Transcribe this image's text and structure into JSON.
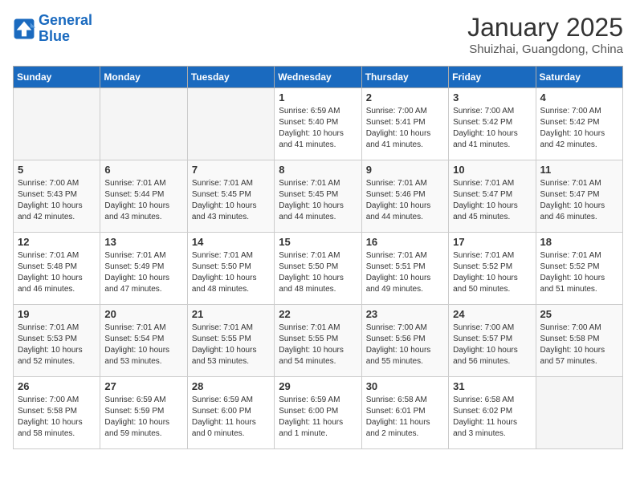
{
  "header": {
    "logo_line1": "General",
    "logo_line2": "Blue",
    "month": "January 2025",
    "location": "Shuizhai, Guangdong, China"
  },
  "days_of_week": [
    "Sunday",
    "Monday",
    "Tuesday",
    "Wednesday",
    "Thursday",
    "Friday",
    "Saturday"
  ],
  "weeks": [
    [
      {
        "day": "",
        "info": ""
      },
      {
        "day": "",
        "info": ""
      },
      {
        "day": "",
        "info": ""
      },
      {
        "day": "1",
        "info": "Sunrise: 6:59 AM\nSunset: 5:40 PM\nDaylight: 10 hours\nand 41 minutes."
      },
      {
        "day": "2",
        "info": "Sunrise: 7:00 AM\nSunset: 5:41 PM\nDaylight: 10 hours\nand 41 minutes."
      },
      {
        "day": "3",
        "info": "Sunrise: 7:00 AM\nSunset: 5:42 PM\nDaylight: 10 hours\nand 41 minutes."
      },
      {
        "day": "4",
        "info": "Sunrise: 7:00 AM\nSunset: 5:42 PM\nDaylight: 10 hours\nand 42 minutes."
      }
    ],
    [
      {
        "day": "5",
        "info": "Sunrise: 7:00 AM\nSunset: 5:43 PM\nDaylight: 10 hours\nand 42 minutes."
      },
      {
        "day": "6",
        "info": "Sunrise: 7:01 AM\nSunset: 5:44 PM\nDaylight: 10 hours\nand 43 minutes."
      },
      {
        "day": "7",
        "info": "Sunrise: 7:01 AM\nSunset: 5:45 PM\nDaylight: 10 hours\nand 43 minutes."
      },
      {
        "day": "8",
        "info": "Sunrise: 7:01 AM\nSunset: 5:45 PM\nDaylight: 10 hours\nand 44 minutes."
      },
      {
        "day": "9",
        "info": "Sunrise: 7:01 AM\nSunset: 5:46 PM\nDaylight: 10 hours\nand 44 minutes."
      },
      {
        "day": "10",
        "info": "Sunrise: 7:01 AM\nSunset: 5:47 PM\nDaylight: 10 hours\nand 45 minutes."
      },
      {
        "day": "11",
        "info": "Sunrise: 7:01 AM\nSunset: 5:47 PM\nDaylight: 10 hours\nand 46 minutes."
      }
    ],
    [
      {
        "day": "12",
        "info": "Sunrise: 7:01 AM\nSunset: 5:48 PM\nDaylight: 10 hours\nand 46 minutes."
      },
      {
        "day": "13",
        "info": "Sunrise: 7:01 AM\nSunset: 5:49 PM\nDaylight: 10 hours\nand 47 minutes."
      },
      {
        "day": "14",
        "info": "Sunrise: 7:01 AM\nSunset: 5:50 PM\nDaylight: 10 hours\nand 48 minutes."
      },
      {
        "day": "15",
        "info": "Sunrise: 7:01 AM\nSunset: 5:50 PM\nDaylight: 10 hours\nand 48 minutes."
      },
      {
        "day": "16",
        "info": "Sunrise: 7:01 AM\nSunset: 5:51 PM\nDaylight: 10 hours\nand 49 minutes."
      },
      {
        "day": "17",
        "info": "Sunrise: 7:01 AM\nSunset: 5:52 PM\nDaylight: 10 hours\nand 50 minutes."
      },
      {
        "day": "18",
        "info": "Sunrise: 7:01 AM\nSunset: 5:52 PM\nDaylight: 10 hours\nand 51 minutes."
      }
    ],
    [
      {
        "day": "19",
        "info": "Sunrise: 7:01 AM\nSunset: 5:53 PM\nDaylight: 10 hours\nand 52 minutes."
      },
      {
        "day": "20",
        "info": "Sunrise: 7:01 AM\nSunset: 5:54 PM\nDaylight: 10 hours\nand 53 minutes."
      },
      {
        "day": "21",
        "info": "Sunrise: 7:01 AM\nSunset: 5:55 PM\nDaylight: 10 hours\nand 53 minutes."
      },
      {
        "day": "22",
        "info": "Sunrise: 7:01 AM\nSunset: 5:55 PM\nDaylight: 10 hours\nand 54 minutes."
      },
      {
        "day": "23",
        "info": "Sunrise: 7:00 AM\nSunset: 5:56 PM\nDaylight: 10 hours\nand 55 minutes."
      },
      {
        "day": "24",
        "info": "Sunrise: 7:00 AM\nSunset: 5:57 PM\nDaylight: 10 hours\nand 56 minutes."
      },
      {
        "day": "25",
        "info": "Sunrise: 7:00 AM\nSunset: 5:58 PM\nDaylight: 10 hours\nand 57 minutes."
      }
    ],
    [
      {
        "day": "26",
        "info": "Sunrise: 7:00 AM\nSunset: 5:58 PM\nDaylight: 10 hours\nand 58 minutes."
      },
      {
        "day": "27",
        "info": "Sunrise: 6:59 AM\nSunset: 5:59 PM\nDaylight: 10 hours\nand 59 minutes."
      },
      {
        "day": "28",
        "info": "Sunrise: 6:59 AM\nSunset: 6:00 PM\nDaylight: 11 hours\nand 0 minutes."
      },
      {
        "day": "29",
        "info": "Sunrise: 6:59 AM\nSunset: 6:00 PM\nDaylight: 11 hours\nand 1 minute."
      },
      {
        "day": "30",
        "info": "Sunrise: 6:58 AM\nSunset: 6:01 PM\nDaylight: 11 hours\nand 2 minutes."
      },
      {
        "day": "31",
        "info": "Sunrise: 6:58 AM\nSunset: 6:02 PM\nDaylight: 11 hours\nand 3 minutes."
      },
      {
        "day": "",
        "info": ""
      }
    ]
  ]
}
